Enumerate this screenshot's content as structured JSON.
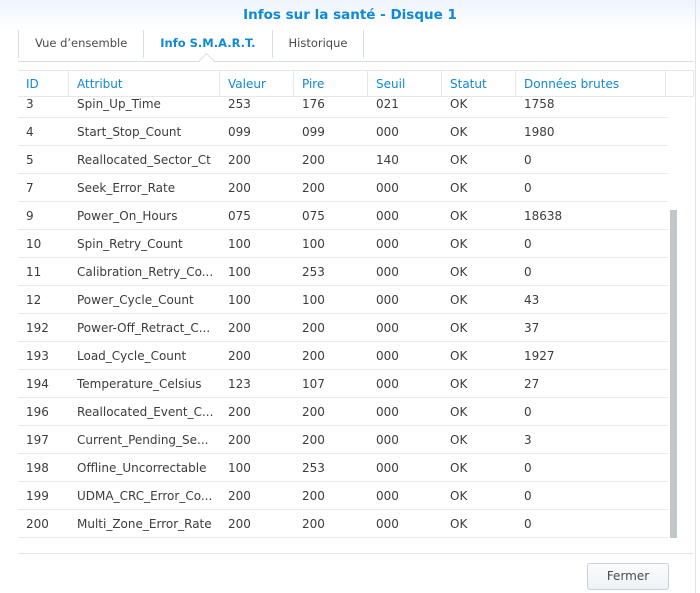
{
  "title": "Infos sur la santé - Disque 1",
  "tabs": [
    {
      "label": "Vue d’ensemble"
    },
    {
      "label": "Info S.M.A.R.T."
    },
    {
      "label": "Historique"
    }
  ],
  "columns": [
    "ID",
    "Attribut",
    "Valeur",
    "Pire",
    "Seuil",
    "Statut",
    "Données brutes"
  ],
  "rows": [
    [
      "3",
      "Spin_Up_Time",
      "253",
      "176",
      "021",
      "OK",
      "1758"
    ],
    [
      "4",
      "Start_Stop_Count",
      "099",
      "099",
      "000",
      "OK",
      "1980"
    ],
    [
      "5",
      "Reallocated_Sector_Ct",
      "200",
      "200",
      "140",
      "OK",
      "0"
    ],
    [
      "7",
      "Seek_Error_Rate",
      "200",
      "200",
      "000",
      "OK",
      "0"
    ],
    [
      "9",
      "Power_On_Hours",
      "075",
      "075",
      "000",
      "OK",
      "18638"
    ],
    [
      "10",
      "Spin_Retry_Count",
      "100",
      "100",
      "000",
      "OK",
      "0"
    ],
    [
      "11",
      "Calibration_Retry_Co...",
      "100",
      "253",
      "000",
      "OK",
      "0"
    ],
    [
      "12",
      "Power_Cycle_Count",
      "100",
      "100",
      "000",
      "OK",
      "43"
    ],
    [
      "192",
      "Power-Off_Retract_C...",
      "200",
      "200",
      "000",
      "OK",
      "37"
    ],
    [
      "193",
      "Load_Cycle_Count",
      "200",
      "200",
      "000",
      "OK",
      "1927"
    ],
    [
      "194",
      "Temperature_Celsius",
      "123",
      "107",
      "000",
      "OK",
      "27"
    ],
    [
      "196",
      "Reallocated_Event_C...",
      "200",
      "200",
      "000",
      "OK",
      "0"
    ],
    [
      "197",
      "Current_Pending_Se...",
      "200",
      "200",
      "000",
      "OK",
      "3"
    ],
    [
      "198",
      "Offline_Uncorrectable",
      "100",
      "253",
      "000",
      "OK",
      "0"
    ],
    [
      "199",
      "UDMA_CRC_Error_Co...",
      "200",
      "200",
      "000",
      "OK",
      "0"
    ],
    [
      "200",
      "Multi_Zone_Error_Rate",
      "200",
      "200",
      "000",
      "OK",
      "0"
    ]
  ],
  "close_label": "Fermer"
}
